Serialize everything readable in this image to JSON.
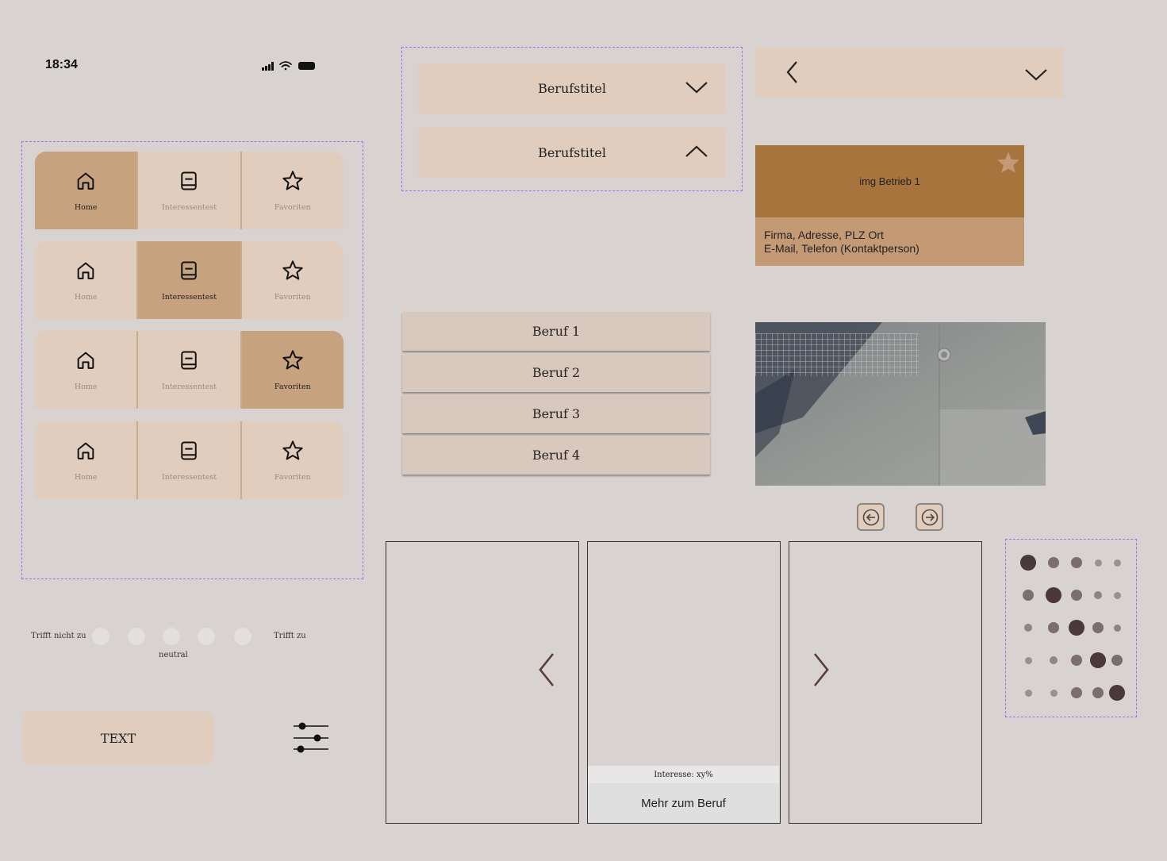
{
  "status_bar": {
    "time": "18:34"
  },
  "nav_bars": [
    {
      "active": 0,
      "items": [
        "Home",
        "Interessentest",
        "Favoriten"
      ]
    },
    {
      "active": 1,
      "items": [
        "Home",
        "Interessentest",
        "Favoriten"
      ]
    },
    {
      "active": 2,
      "items": [
        "Home",
        "Interessentest",
        "Favoriten"
      ]
    },
    {
      "active": -1,
      "items": [
        "Home",
        "Interessentest",
        "Favoriten"
      ]
    }
  ],
  "rating_scale": {
    "left_label": "Trifft nicht zu",
    "right_label": "Trifft zu",
    "middle_label": "neutral",
    "steps": 5
  },
  "text_button": {
    "label": "TEXT"
  },
  "dropdowns": [
    {
      "label": "Berufstitel",
      "state": "collapsed",
      "icon": "chevron-down-icon"
    },
    {
      "label": "Berufstitel",
      "state": "expanded",
      "icon": "chevron-up-icon"
    }
  ],
  "beruf_list": [
    "Beruf 1",
    "Beruf 2",
    "Beruf 3",
    "Beruf 4"
  ],
  "business_card": {
    "image_label": "img Betrieb 1",
    "line1": "Firma, Adresse, PLZ Ort",
    "line2": "E-Mail, Telefon (Kontaktperson)",
    "favorite_icon": "star-icon"
  },
  "carousel_card": {
    "interest": "Interesse: xy%",
    "button": "Mehr zum Beruf"
  },
  "colors": {
    "background": "#d8d3d0",
    "beige": "#e0cdbd",
    "active_tan": "#c6a27e",
    "brown": "#a6743c",
    "dot_dark": "#4a383b"
  }
}
